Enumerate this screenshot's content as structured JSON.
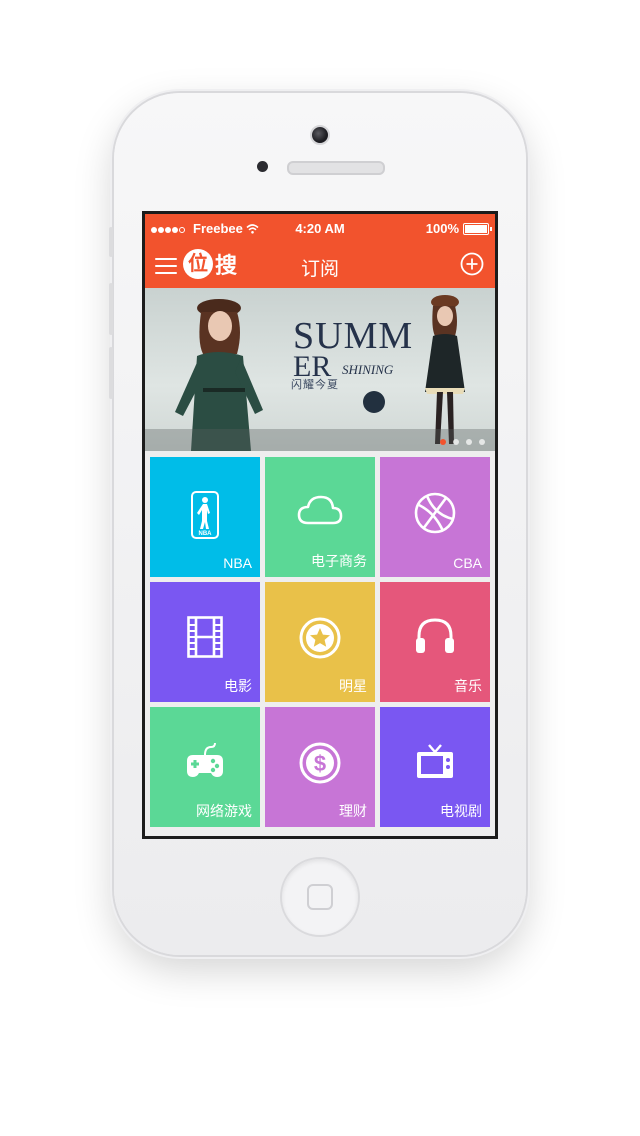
{
  "status_bar": {
    "carrier": "Freebee",
    "time": "4:20 AM",
    "battery": "100%"
  },
  "nav_bar": {
    "logo_mark": "位",
    "logo_text": "搜",
    "title": "订阅"
  },
  "banner": {
    "headline_line1": "SUMM",
    "headline_line2": "ER",
    "headline_line3": "SHINING",
    "subtitle": "闪耀今夏",
    "pages": 4,
    "active_page": 1
  },
  "tiles": [
    {
      "label": "NBA",
      "color": "#00bde8",
      "icon": "nba-logo-icon"
    },
    {
      "label": "电子商务",
      "color": "#5bd896",
      "icon": "cloud-icon"
    },
    {
      "label": "CBA",
      "color": "#c775d6",
      "icon": "basketball-icon"
    },
    {
      "label": "电影",
      "color": "#7a57f2",
      "icon": "film-icon"
    },
    {
      "label": "明星",
      "color": "#e9c149",
      "icon": "star-icon"
    },
    {
      "label": "音乐",
      "color": "#e5577b",
      "icon": "headphones-icon"
    },
    {
      "label": "网络游戏",
      "color": "#5bd896",
      "icon": "gamepad-icon"
    },
    {
      "label": "理财",
      "color": "#c775d6",
      "icon": "dollar-icon"
    },
    {
      "label": "电视剧",
      "color": "#7a57f2",
      "icon": "tv-icon"
    }
  ],
  "colors": {
    "brand": "#f2532d"
  }
}
